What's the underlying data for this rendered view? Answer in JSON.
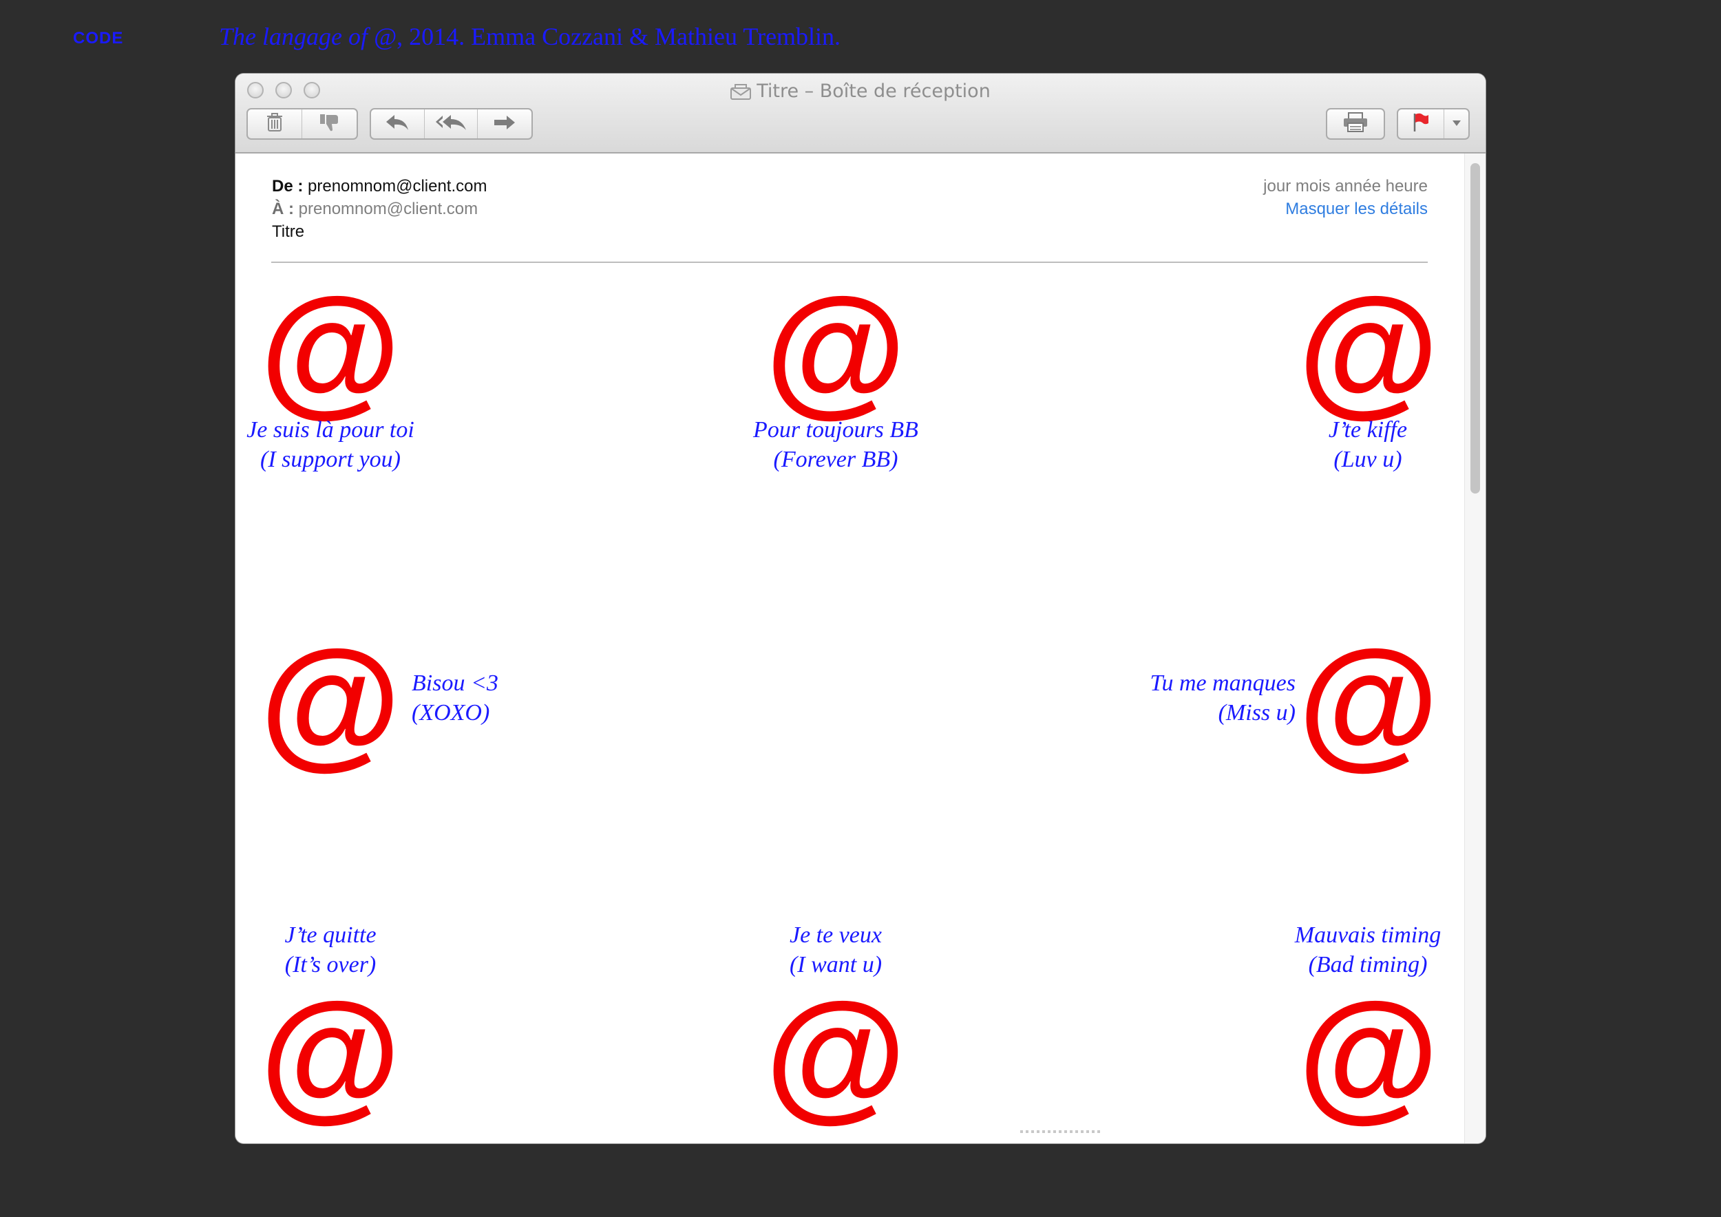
{
  "top": {
    "code_label": "CODE",
    "credit_title": "The langage of @",
    "credit_rest": ", 2014. Emma Cozzani & Mathieu Tremblin."
  },
  "window": {
    "title": "Titre – Boîte de réception",
    "toolbar": {
      "delete_icon": "trash-icon",
      "junk_icon": "thumbs-down-icon",
      "reply_icon": "reply-arrow-icon",
      "reply_all_icon": "reply-all-arrow-icon",
      "forward_icon": "forward-arrow-icon",
      "print_icon": "printer-icon",
      "flag_icon": "red-flag-icon"
    }
  },
  "mail": {
    "from_label": "De :",
    "from_value": "prenomnom@client.com",
    "to_label": "À :",
    "to_value": "prenomnom@client.com",
    "subject": "Titre",
    "date": "jour mois année heure",
    "hide_details": "Masquer les détails"
  },
  "symbols": {
    "at": "@"
  },
  "messages": [
    {
      "fr": "Je suis là pour toi",
      "en": "(I support you)"
    },
    {
      "fr": "Pour toujours BB",
      "en": "(Forever BB)"
    },
    {
      "fr": "J’te kiffe",
      "en": "(Luv u)"
    },
    {
      "fr": "Bisou <3",
      "en": "(XOXO)"
    },
    {
      "fr": "Tu me manques",
      "en": "(Miss u)"
    },
    {
      "fr": "J’te quitte",
      "en": "(It’s over)"
    },
    {
      "fr": "Je te veux",
      "en": "(I want u)"
    },
    {
      "fr": "Mauvais timing",
      "en": "(Bad timing)"
    }
  ],
  "colors": {
    "at_red": "#f20000",
    "text_blue": "#1a1aff",
    "link_blue": "#2f7de0",
    "background": "#2d2d2d"
  }
}
